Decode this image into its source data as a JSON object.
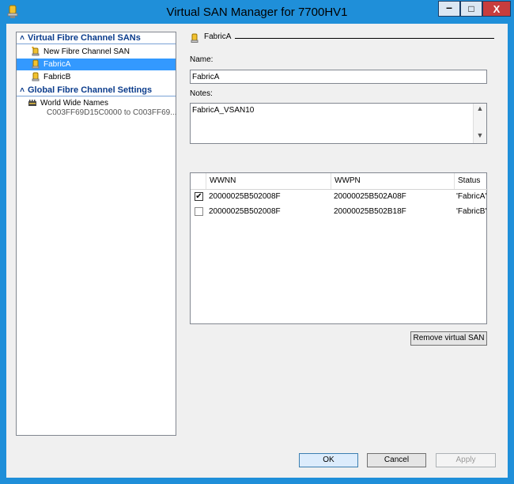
{
  "window": {
    "title": "Virtual SAN Manager for 7700HV1",
    "minimize_label": "–",
    "maximize_label": "□",
    "close_label": "X"
  },
  "tree": {
    "sections": [
      {
        "label": "Virtual Fibre Channel SANs",
        "items": [
          {
            "label": "New Fibre Channel SAN",
            "icon": "new-san-icon"
          },
          {
            "label": "FabricA",
            "icon": "fabric-icon",
            "selected": true
          },
          {
            "label": "FabricB",
            "icon": "fabric-icon"
          }
        ]
      },
      {
        "label": "Global Fibre Channel Settings",
        "items": [
          {
            "label": "World Wide Names",
            "icon": "wwn-icon",
            "sub": "C003FF69D15C0000 to C003FF69..."
          }
        ]
      }
    ]
  },
  "detail": {
    "group_title": "FabricA",
    "name_label": "Name:",
    "name_value": "FabricA",
    "notes_label": "Notes:",
    "notes_value": "FabricA_VSAN10",
    "grid": {
      "columns": [
        "WWNN",
        "WWPN",
        "Status"
      ],
      "rows": [
        {
          "checked": true,
          "wwnn": "20000025B502008F",
          "wwpn": "20000025B502A08F",
          "status": "'FabricA'"
        },
        {
          "checked": false,
          "wwnn": "20000025B502008F",
          "wwpn": "20000025B502B18F",
          "status": "'FabricB'"
        }
      ]
    },
    "remove_label": "Remove virtual SAN"
  },
  "footer": {
    "ok_label": "OK",
    "cancel_label": "Cancel",
    "apply_label": "Apply"
  }
}
